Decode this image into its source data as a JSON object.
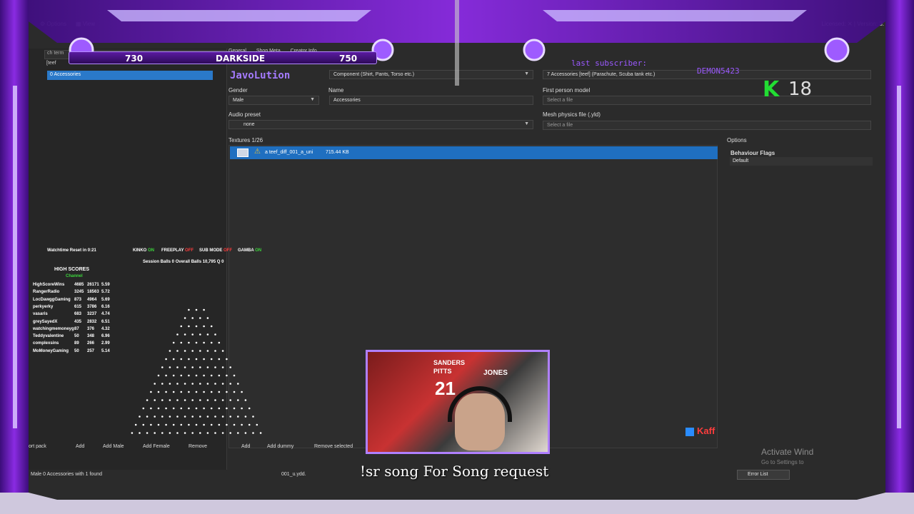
{
  "menu": {
    "options": "Options",
    "view": "View",
    "licensed": "Licensed:",
    "version": "Version: 3."
  },
  "left": {
    "selected_row": "0 Accessories",
    "toolbar": [
      "ort pack",
      "Add",
      "Add Male",
      "Add Female",
      "Remove",
      "Add",
      "Add dummy",
      "Remove selected"
    ]
  },
  "tabs": [
    "General",
    "Shop Meta",
    "Creator Info"
  ],
  "form": {
    "type_value": "Component (Shirt, Pants, Torso etc.)",
    "slot_value": "7   Accessories [teef] (Parachute, Scuba tank etc.)",
    "gender_label": "Gender",
    "gender_value": "Male",
    "name_label": "Name",
    "name_value": "Accessories",
    "fp_label": "First person model",
    "fp_value": "Select a file",
    "audio_label": "Audio preset",
    "audio_value": "none",
    "mesh_label": "Mesh physics file (.yld)",
    "mesh_value": "Select a file",
    "textures_label": "Textures 1/26",
    "texture_name": "a  teef_diff_001_a_uni",
    "texture_size": "715.44 KB"
  },
  "options": {
    "title": "Options",
    "flags_label": "Behaviour Flags",
    "flags_value": "Default"
  },
  "status": {
    "text": "Male 0 Accessories with 1 found",
    "tail": "001_u.ydd.",
    "error_list": "Error List"
  },
  "activate": {
    "line1": "Activate Wind",
    "line2": "Go to Settings to"
  },
  "overlay": {
    "score_left": "730",
    "score_mid": "DARKSIDE",
    "score_right": "750",
    "handle": "JavoLution",
    "last_sub": "last subscriber:",
    "last_sub_name": "DEMON5423",
    "k_count": "18",
    "song_request": "!sr song For Song request",
    "chat_name": "Kaff"
  },
  "plinko": {
    "watchtime": "Watchtime Reset in 0:21",
    "kinko": "KINKO",
    "kinko_state": "ON",
    "freeplay": "FREEPLAY",
    "freeplay_state": "OFF",
    "submode": "SUB MODE",
    "submode_state": "OFF",
    "gamba": "GAMBA",
    "gamba_state": "ON",
    "stats": "Session Balls  0     Overall Balls  10,795     Q  0",
    "hs_title": "HIGH SCORES",
    "hs_channel": "Channel",
    "rows": [
      [
        "HighScoreWins",
        "4685",
        "26171",
        "5.59"
      ],
      [
        "RangerRadio",
        "3245",
        "18563",
        "5.72"
      ],
      [
        "LocDawggGaming",
        "873",
        "4964",
        "5.69"
      ],
      [
        "perkyerky",
        "615",
        "3786",
        "6.16"
      ],
      [
        "vasaris",
        "683",
        "3237",
        "4.74"
      ],
      [
        "greySayedX",
        "435",
        "2832",
        "6.51"
      ],
      [
        "watchingmemoneyg",
        "87",
        "376",
        "4.32"
      ],
      [
        "Teddyvalentine",
        "50",
        "348",
        "6.96"
      ],
      [
        "complexsins",
        "89",
        "266",
        "2.99"
      ],
      [
        "MoMoneyGaming",
        "50",
        "257",
        "5.14"
      ]
    ]
  },
  "cam": {
    "name1": "PITTS",
    "name2": "SANDERS",
    "num": "21",
    "name3": "JONES"
  },
  "colors": {
    "accent": "#8a2be2",
    "selection": "#1f6fc0",
    "on": "#3cd63c",
    "off": "#ff3d3d"
  }
}
